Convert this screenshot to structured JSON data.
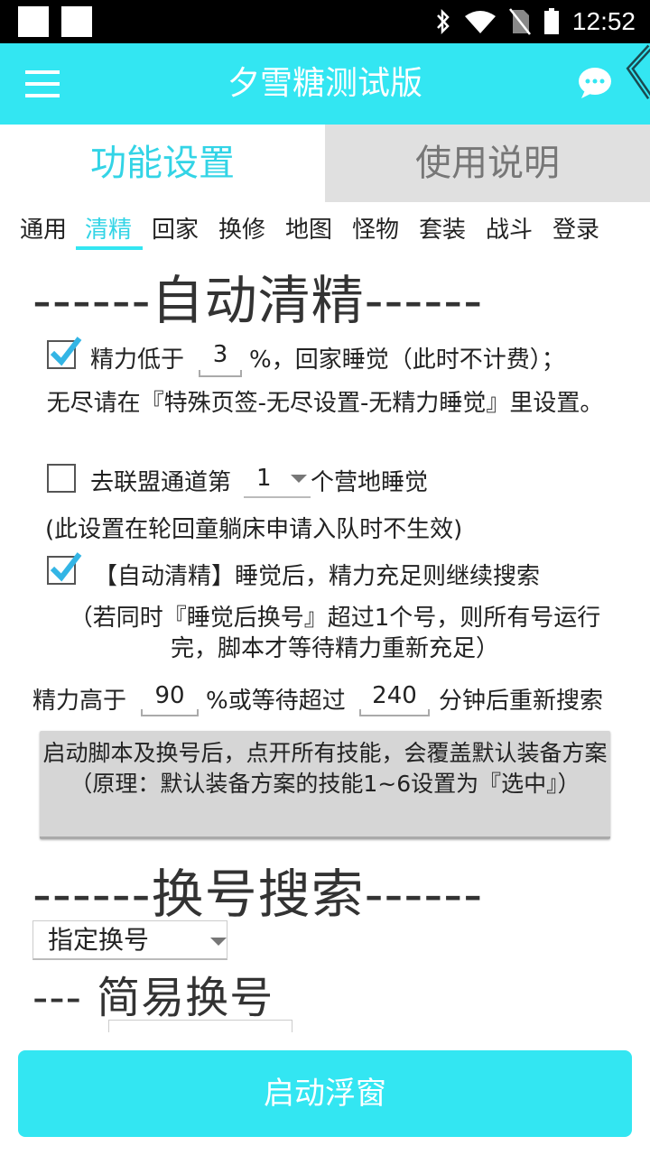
{
  "status_bar": {
    "time": "12:52",
    "icons": [
      "bluetooth-icon",
      "wifi-icon",
      "no-sim-icon",
      "battery-icon"
    ]
  },
  "app_bar": {
    "title": "夕雪糖测试版",
    "menu_icon": "hamburger-icon",
    "chat_icon": "chat-bubble-icon"
  },
  "main_tabs": [
    {
      "label": "功能设置",
      "active": true
    },
    {
      "label": "使用说明",
      "active": false
    }
  ],
  "sub_tabs": [
    {
      "label": "通用"
    },
    {
      "label": "清精",
      "active": true
    },
    {
      "label": "回家"
    },
    {
      "label": "换修"
    },
    {
      "label": "地图"
    },
    {
      "label": "怪物"
    },
    {
      "label": "套装"
    },
    {
      "label": "战斗"
    },
    {
      "label": "登录"
    }
  ],
  "section_auto_refine": {
    "header": "------自动清精------",
    "row1": {
      "checked": true,
      "label_before": "精力低于",
      "value": "3",
      "label_after": "%，回家睡觉（此时不计费）；"
    },
    "note1": "无尽请在『特殊页签-无尽设置-无精力睡觉』里设置。",
    "row2": {
      "checked": false,
      "label_before": "去联盟通道第",
      "value": "1",
      "label_after": "个营地睡觉"
    },
    "note2": "(此设置在轮回童躺床申请入队时不生效)",
    "row3": {
      "checked": true,
      "label": "【自动清精】睡觉后，精力充足则继续搜索"
    },
    "note3": "（若同时『睡觉后换号』超过1个号，则所有号运行完，脚本才等待精力重新充足）",
    "row4": {
      "label_before": "精力高于",
      "value1": "90",
      "label_mid": "%或等待超过",
      "value2": "240",
      "label_after": "分钟后重新搜索"
    },
    "button": "启动脚本及换号后，点开所有技能，会覆盖默认装备方案（原理：默认装备方案的技能1~6设置为『选中』）"
  },
  "section_switch": {
    "header": "------换号搜索------",
    "dropdown": "指定换号",
    "subheader": "--- 简易换号"
  },
  "bottom_button": "启动浮窗",
  "colors": {
    "accent": "#33e6f2",
    "accent_text": "#33d4e6",
    "checkbox": "#33b5e5"
  }
}
